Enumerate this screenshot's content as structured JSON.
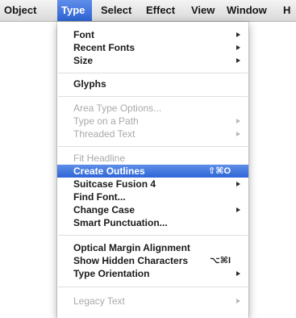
{
  "menubar": {
    "items": [
      "Object",
      "Type",
      "Select",
      "Effect",
      "View",
      "Window",
      "H"
    ],
    "active": "Type"
  },
  "menu": {
    "items": [
      {
        "label": "Font",
        "submenu": true,
        "enabled": true
      },
      {
        "label": "Recent Fonts",
        "submenu": true,
        "enabled": true
      },
      {
        "label": "Size",
        "submenu": true,
        "enabled": true
      },
      {
        "label": "Glyphs",
        "submenu": false,
        "enabled": true
      },
      {
        "label": "Area Type Options...",
        "submenu": false,
        "enabled": false
      },
      {
        "label": "Type on a Path",
        "submenu": true,
        "enabled": false
      },
      {
        "label": "Threaded Text",
        "submenu": true,
        "enabled": false
      },
      {
        "label": "Fit Headline",
        "submenu": false,
        "enabled": false
      },
      {
        "label": "Create Outlines",
        "submenu": false,
        "enabled": true,
        "highlighted": true,
        "shortcut": "⇧⌘O"
      },
      {
        "label": "Suitcase Fusion 4",
        "submenu": true,
        "enabled": true
      },
      {
        "label": "Find Font...",
        "submenu": false,
        "enabled": true
      },
      {
        "label": "Change Case",
        "submenu": true,
        "enabled": true
      },
      {
        "label": "Smart Punctuation...",
        "submenu": false,
        "enabled": true
      },
      {
        "label": "Optical Margin Alignment",
        "submenu": false,
        "enabled": true
      },
      {
        "label": "Show Hidden Characters",
        "submenu": false,
        "enabled": true,
        "shortcut": "⌥⌘I"
      },
      {
        "label": "Type Orientation",
        "submenu": true,
        "enabled": true
      },
      {
        "label": "Legacy Text",
        "submenu": true,
        "enabled": false
      }
    ]
  },
  "colors": {
    "highlight": "#2f66d6",
    "disabled_text": "#a9a9a9"
  }
}
